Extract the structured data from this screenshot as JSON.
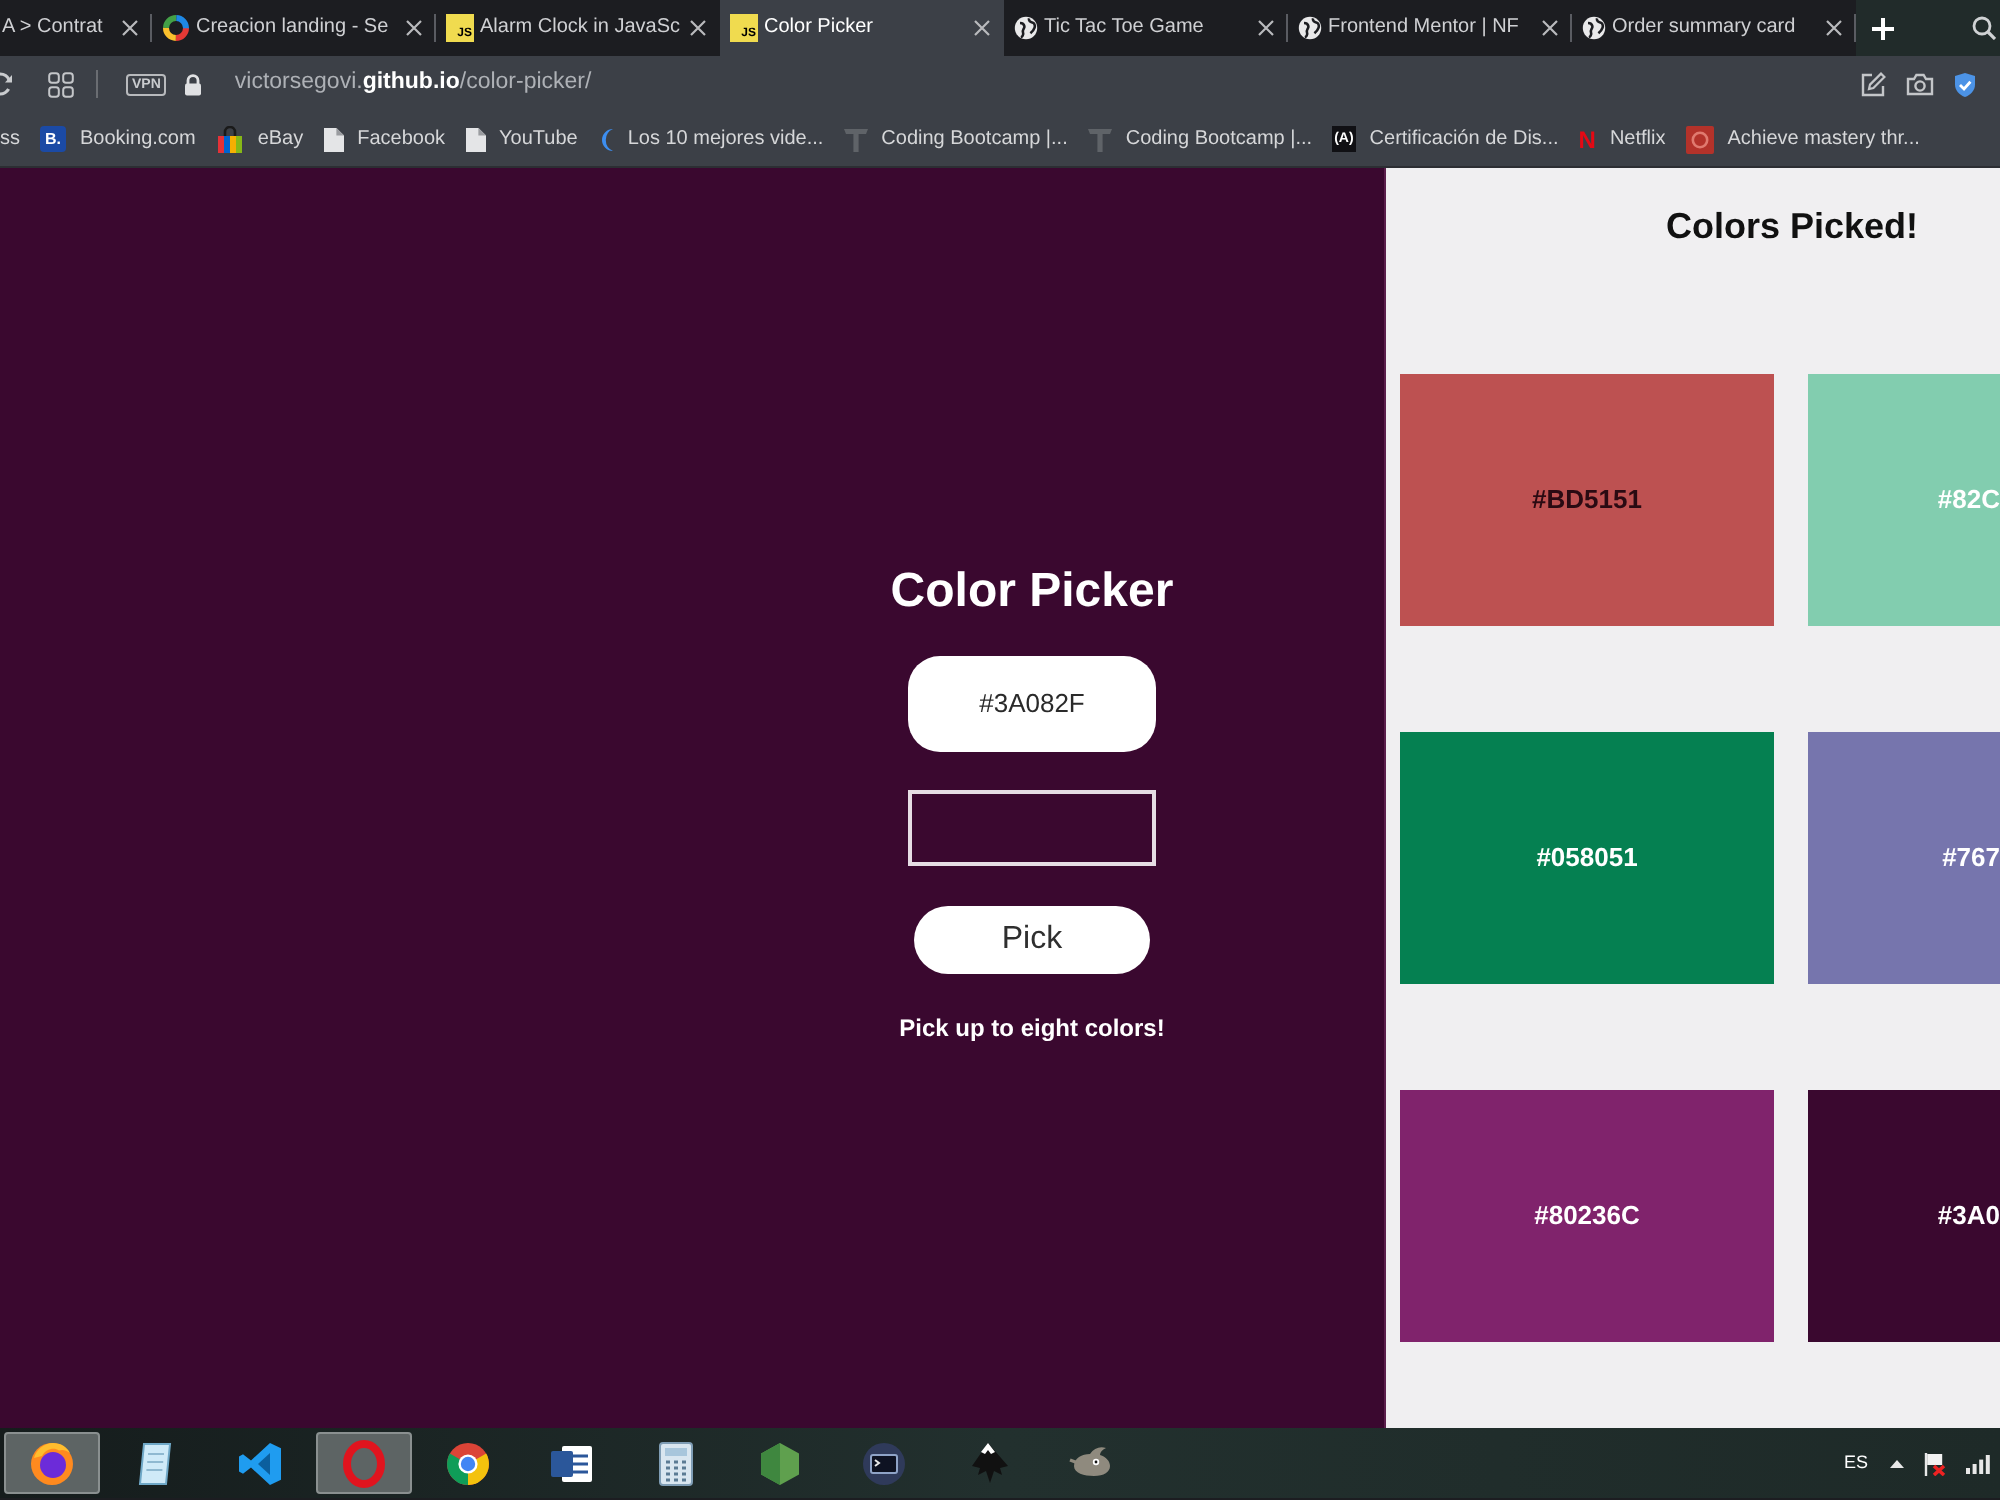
{
  "tabs": [
    {
      "title": "A > Contrat",
      "kind": "plain",
      "selected": false
    },
    {
      "title": "Creacion landing - Se",
      "kind": "ring",
      "selected": false
    },
    {
      "title": "Alarm Clock in JavaSc",
      "kind": "js",
      "logo_text": "JS",
      "selected": false
    },
    {
      "title": "Color Picker",
      "kind": "js",
      "logo_text": "JS",
      "selected": true
    },
    {
      "title": "Tic Tac Toe Game",
      "kind": "globe",
      "selected": false
    },
    {
      "title": "Frontend Mentor | NF",
      "kind": "globe",
      "selected": false
    },
    {
      "title": "Order summary card",
      "kind": "globe",
      "selected": false
    }
  ],
  "address_bar": {
    "vpn_badge": "VPN",
    "url": "victorsegovi.**github.io**/color-picker/"
  },
  "bookmarks": [
    {
      "label": "ss",
      "kind": "plain"
    },
    {
      "label": "Booking.com",
      "kind": "letter",
      "logo_text": "B."
    },
    {
      "label": "eBay",
      "kind": "bag"
    },
    {
      "label": "Facebook",
      "kind": "page"
    },
    {
      "label": "YouTube",
      "kind": "page"
    },
    {
      "label": "Los 10 mejores vide...",
      "kind": "crescent"
    },
    {
      "label": "Coding Bootcamp |...",
      "kind": "t-logo"
    },
    {
      "label": "Coding Bootcamp |...",
      "kind": "t-logo"
    },
    {
      "label": "Certificación de Dis...",
      "kind": "letter-dark",
      "logo_text": "(A)"
    },
    {
      "label": "Netflix",
      "kind": "letter-red",
      "logo_text": "N"
    },
    {
      "label": "Achieve mastery thr...",
      "kind": "square"
    }
  ],
  "picker": {
    "title": "Color Picker",
    "input_value": "#3A082F",
    "button": "Pick",
    "hint": "Pick up to eight colors!"
  },
  "picked": {
    "title": "Colors Picked!",
    "swatches": [
      {
        "label": "#BD5151",
        "color": "#bd5151",
        "dark_label": true
      },
      {
        "label": "#82C",
        "color": "#82cdaf",
        "dark_label": false
      },
      {
        "label": "#058051",
        "color": "#058051",
        "dark_label": false
      },
      {
        "label": "#767",
        "color": "#7675ad",
        "dark_label": false
      },
      {
        "label": "#80236C",
        "color": "#80236c",
        "dark_label": false
      },
      {
        "label": "#3A0",
        "color": "#3a082f",
        "dark_label": false
      }
    ]
  },
  "taskbar": {
    "apps": [
      {
        "kind": "firefox",
        "active": true
      },
      {
        "kind": "notepad",
        "active": false
      },
      {
        "kind": "vscode",
        "active": false
      },
      {
        "kind": "opera",
        "active": true
      },
      {
        "kind": "chrome",
        "active": false
      },
      {
        "kind": "word",
        "active": false
      },
      {
        "kind": "calculator",
        "active": false
      },
      {
        "kind": "node",
        "active": false
      },
      {
        "kind": "terminal",
        "active": false
      },
      {
        "kind": "inkscape",
        "active": false
      },
      {
        "kind": "gimp",
        "active": false
      }
    ],
    "language": "ES"
  }
}
